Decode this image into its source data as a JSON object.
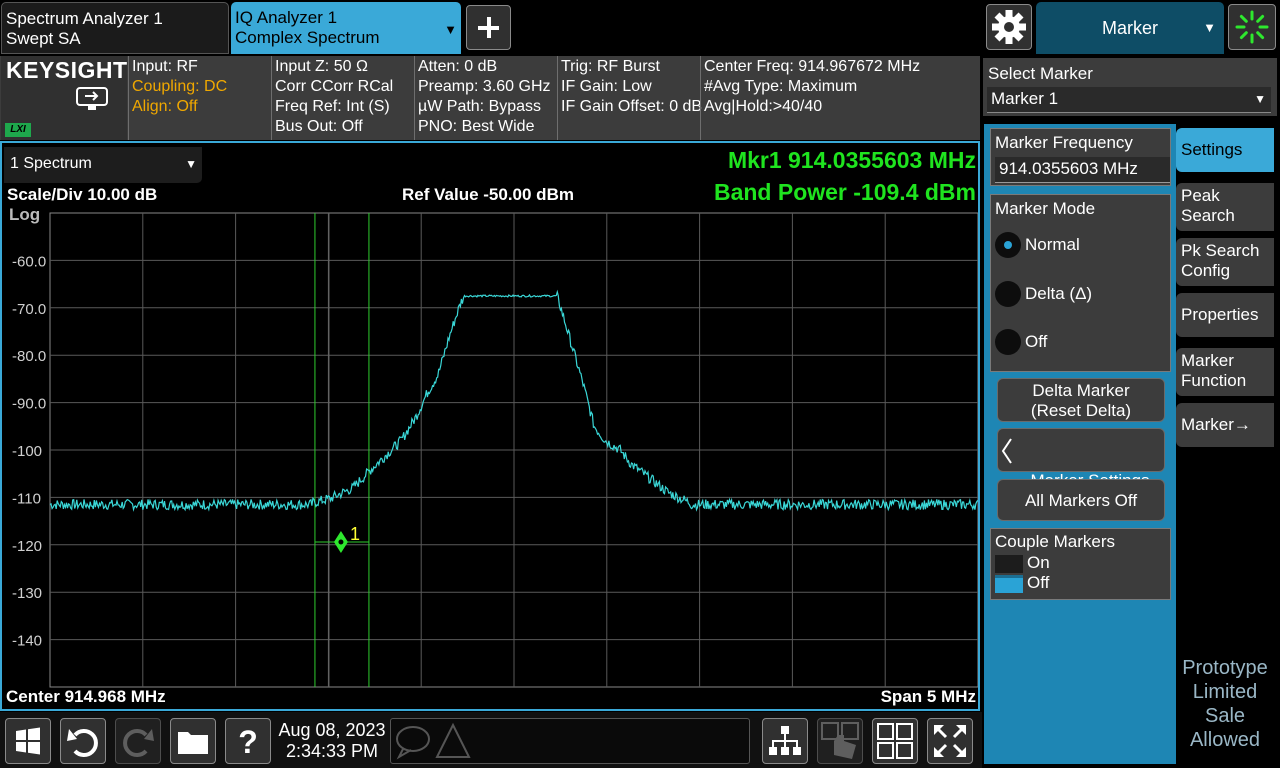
{
  "tabs": [
    {
      "line1": "Spectrum Analyzer 1",
      "line2": "Swept SA"
    },
    {
      "line1": "IQ Analyzer 1",
      "line2": "Complex Spectrum"
    }
  ],
  "top_right": {
    "menu_label": "Marker"
  },
  "logo": {
    "brand": "KEYSIGHT",
    "badge": "LXI"
  },
  "info": {
    "col1": [
      "Input: RF",
      "Coupling: DC",
      "Align: Off"
    ],
    "col2": [
      "Input Z: 50 Ω",
      "Corr CCorr RCal",
      "Freq Ref: Int (S)",
      "Bus Out: Off"
    ],
    "col3": [
      "Atten: 0 dB",
      "Preamp: 3.60 GHz",
      "µW Path: Bypass",
      "PNO: Best Wide"
    ],
    "col4": [
      "Trig: RF Burst",
      "IF Gain: Low",
      "IF Gain Offset: 0 dB"
    ],
    "col5": [
      "Center Freq: 914.967672 MHz",
      "#Avg Type: Maximum",
      "Avg|Hold:>40/40"
    ]
  },
  "graph": {
    "window_select": "1 Spectrum",
    "marker_readout": "Mkr1  914.0355603 MHz",
    "band_power": "Band Power  -109.4 dBm",
    "scale_div": "Scale/Div 10.00 dB",
    "ref_value": "Ref Value -50.00 dBm",
    "scale_type": "Log",
    "y_ticks": [
      "-60.0",
      "-70.0",
      "-80.0",
      "-90.0",
      "-100",
      "-110",
      "-120",
      "-130",
      "-140"
    ],
    "center": "Center 914.968 MHz",
    "span": "Span 5 MHz",
    "marker_label": "1"
  },
  "chart_data": {
    "type": "line",
    "x_unit": "MHz",
    "xlim": [
      912.468,
      917.468
    ],
    "ylim": [
      -150,
      -50
    ],
    "y_ticks": [
      -60,
      -70,
      -80,
      -90,
      -100,
      -110,
      -120,
      -130,
      -140
    ],
    "trace_color": "#3ad7d7",
    "marker": {
      "freq_mhz": 914.0355603,
      "level_dbm": -119.4
    },
    "noise_floor_dbm": -111.5,
    "channel_top_dbm": -67.5,
    "channel_edges_mhz": [
      914.7,
      915.2
    ],
    "skirt_points": [
      [
        913.88,
        -111.2
      ],
      [
        913.98,
        -110.2
      ],
      [
        914.1,
        -108
      ],
      [
        914.2,
        -104
      ],
      [
        914.28,
        -101
      ],
      [
        914.36,
        -98
      ],
      [
        914.44,
        -93
      ],
      [
        914.5,
        -88
      ],
      [
        914.56,
        -84
      ],
      [
        914.62,
        -76
      ],
      [
        914.68,
        -69
      ],
      [
        914.7,
        -67.5
      ],
      [
        915.2,
        -67.5
      ],
      [
        915.22,
        -70
      ],
      [
        915.28,
        -78
      ],
      [
        915.34,
        -86
      ],
      [
        915.4,
        -95
      ],
      [
        915.46,
        -98
      ],
      [
        915.54,
        -100
      ],
      [
        915.6,
        -103
      ],
      [
        915.7,
        -106
      ],
      [
        915.8,
        -109
      ],
      [
        915.92,
        -111.2
      ]
    ],
    "grid": true
  },
  "right_panel": {
    "select_marker_label": "Select Marker",
    "select_marker_value": "Marker 1",
    "marker_frequency_label": "Marker Frequency",
    "marker_frequency_value": "914.0355603 MHz",
    "marker_mode_label": "Marker Mode",
    "modes": [
      "Normal",
      "Delta (Δ)",
      "Off"
    ],
    "selected_mode": "Normal",
    "delta_marker_btn": "Delta Marker\n(Reset Delta)",
    "settings_diagram_btn": "Marker Settings\nDiagram",
    "all_off_btn": "All Markers Off",
    "couple_label": "Couple Markers",
    "couple_on": "On",
    "couple_off": "Off",
    "side_tabs": [
      "Settings",
      "Peak\nSearch",
      "Pk Search\nConfig",
      "Properties",
      "Marker\nFunction",
      "Marker→"
    ],
    "watermark": "Prototype\nLimited\nSale\nAllowed"
  },
  "bottom": {
    "date": "Aug 08, 2023",
    "time": "2:34:33 PM"
  }
}
